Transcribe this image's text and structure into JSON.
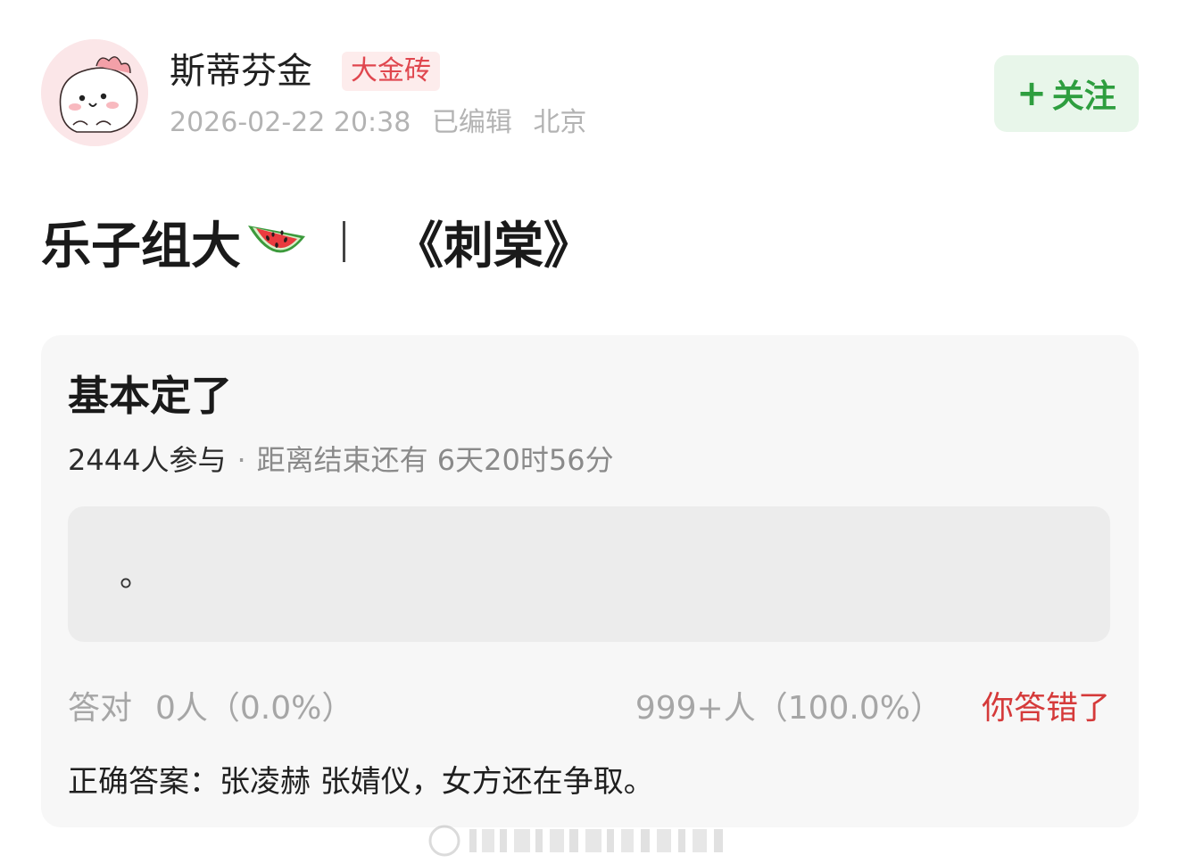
{
  "user": {
    "name": "斯蒂芬金",
    "badge": "大金砖",
    "timestamp": "2026-02-22 20:38",
    "edited": "已编辑",
    "location": "北京"
  },
  "follow": {
    "label": "关注"
  },
  "post": {
    "title_left": "乐子组大",
    "title_right": "《刺棠》"
  },
  "poll": {
    "question": "基本定了",
    "participants": "2444人参与",
    "remaining": "距离结束还有 6天20时56分",
    "answer_text": "。",
    "correct_label": "答对",
    "correct_count": "0人（0.0%）",
    "wrong_count": "999+人（100.0%）",
    "wrong_tag": "你答错了",
    "answer_line": "正确答案：张凌赫 张婧仪，女方还在争取。"
  },
  "colors": {
    "follow_green": "#2e9e3f",
    "badge_red": "#e0464e",
    "wrong_red": "#d53a3a"
  },
  "icons": {
    "avatar": "pink-dino-avatar",
    "title_emoji": "watermelon-icon"
  }
}
